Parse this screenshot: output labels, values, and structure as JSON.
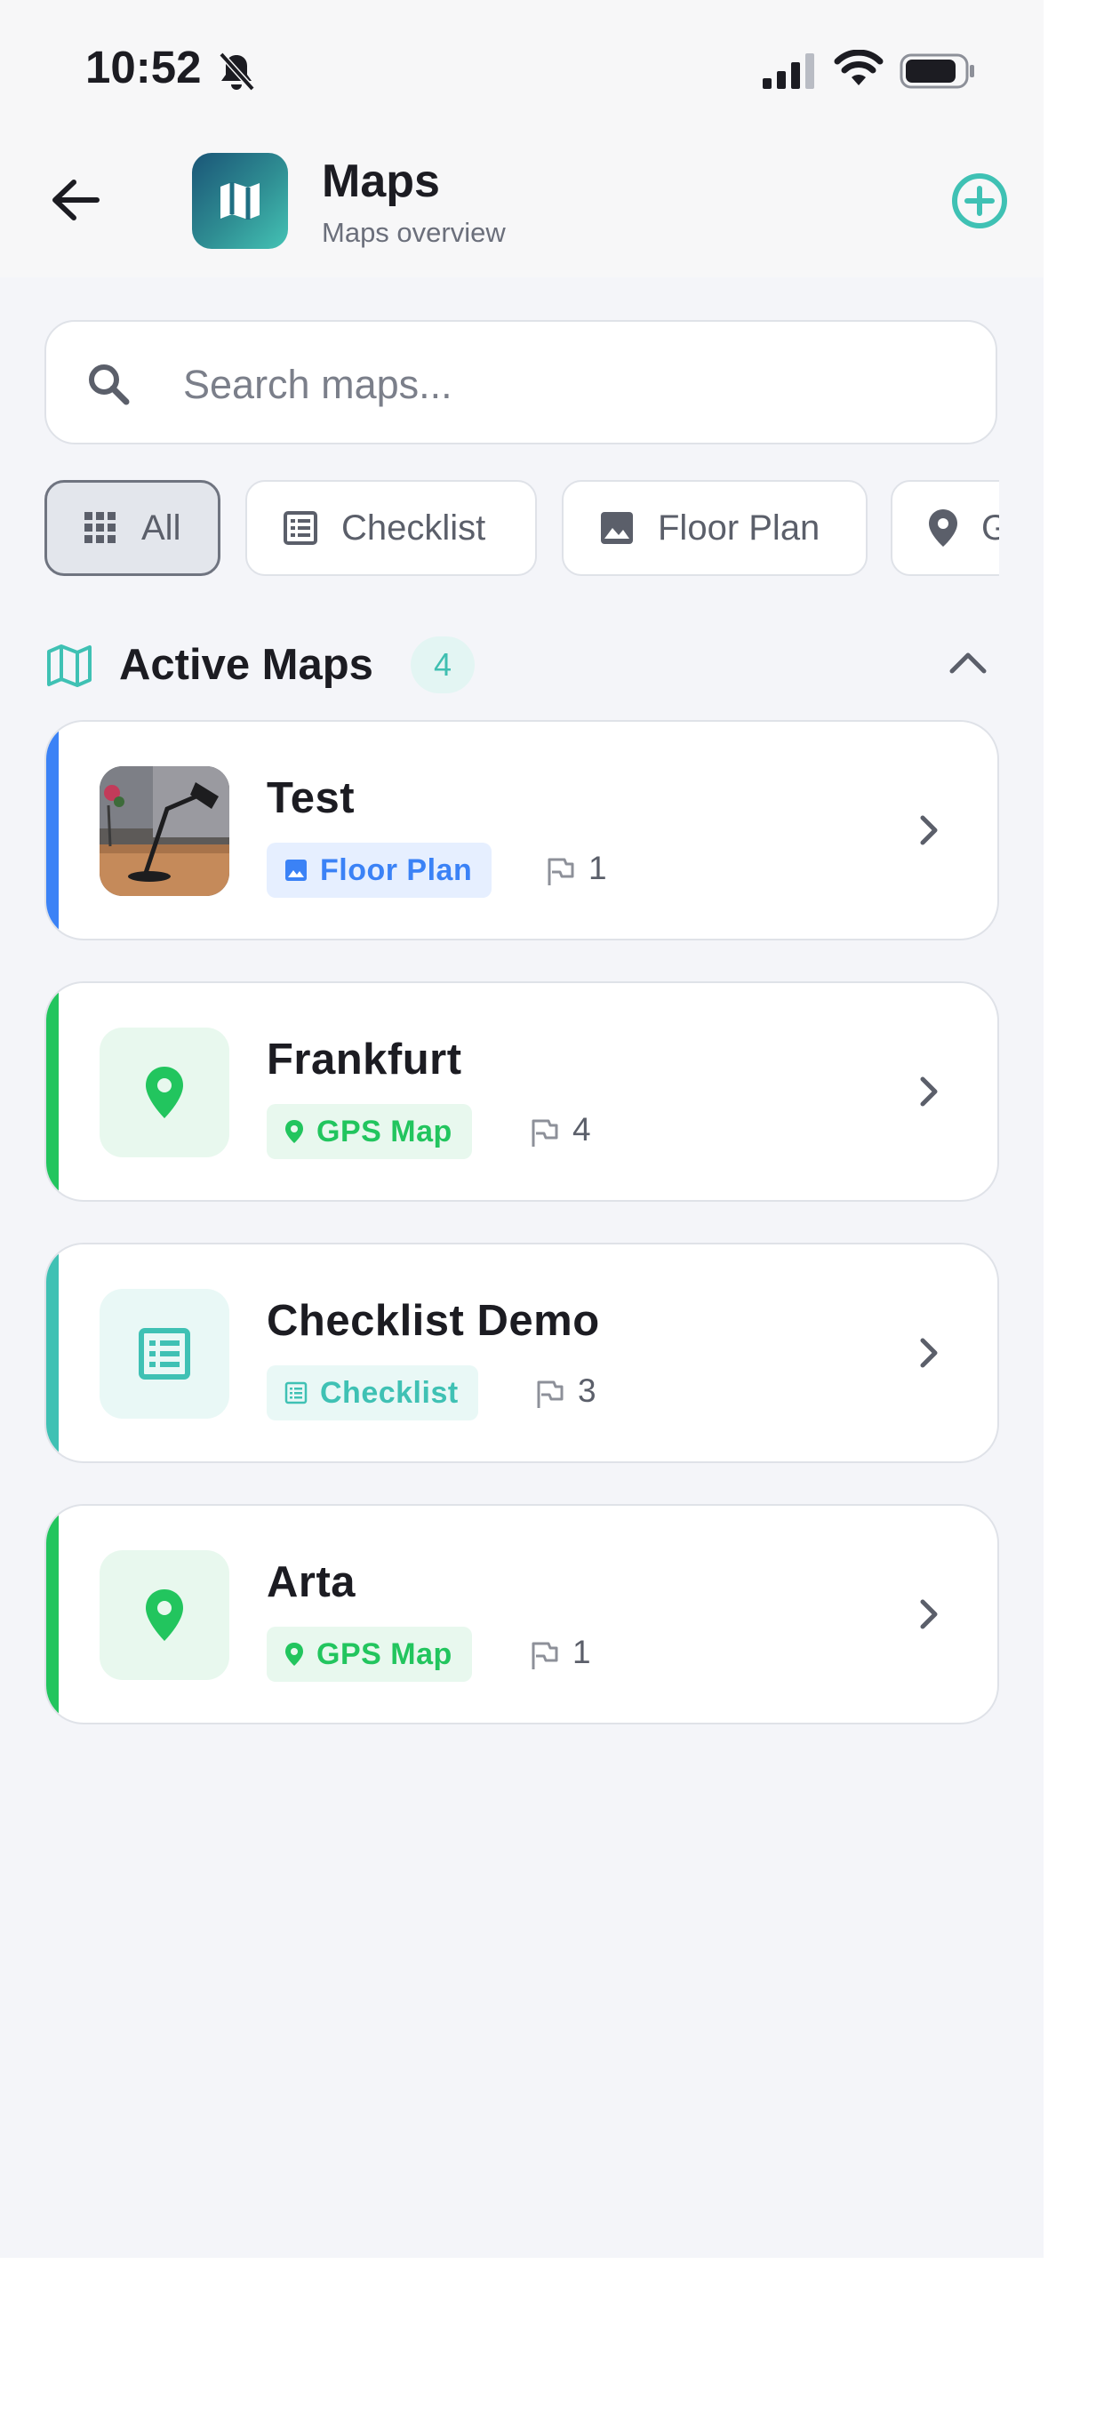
{
  "status_bar": {
    "time": "10:52"
  },
  "header": {
    "title": "Maps",
    "subtitle": "Maps overview"
  },
  "search": {
    "placeholder": "Search maps...",
    "value": ""
  },
  "filters": [
    {
      "label": "All",
      "icon": "grid-icon",
      "active": true
    },
    {
      "label": "Checklist",
      "icon": "checklist-icon",
      "active": false
    },
    {
      "label": "Floor Plan",
      "icon": "image-icon",
      "active": false
    },
    {
      "label": "GPS Map",
      "icon": "location-pin-icon",
      "active": false
    }
  ],
  "section": {
    "title": "Active Maps",
    "count": "4"
  },
  "maps": [
    {
      "name": "Test",
      "type": "Floor Plan",
      "markers": "1",
      "accent": "#3b82f6"
    },
    {
      "name": "Frankfurt",
      "type": "GPS Map",
      "markers": "4",
      "accent": "#22c55e"
    },
    {
      "name": "Checklist Demo",
      "type": "Checklist",
      "markers": "3",
      "accent": "#3fc1b4"
    },
    {
      "name": "Arta",
      "type": "GPS Map",
      "markers": "1",
      "accent": "#22c55e"
    }
  ],
  "colors": {
    "floor_plan": "#3b82f6",
    "gps_map": "#22c55e",
    "checklist": "#3fc1b4",
    "brand": "#3fc1b4"
  }
}
